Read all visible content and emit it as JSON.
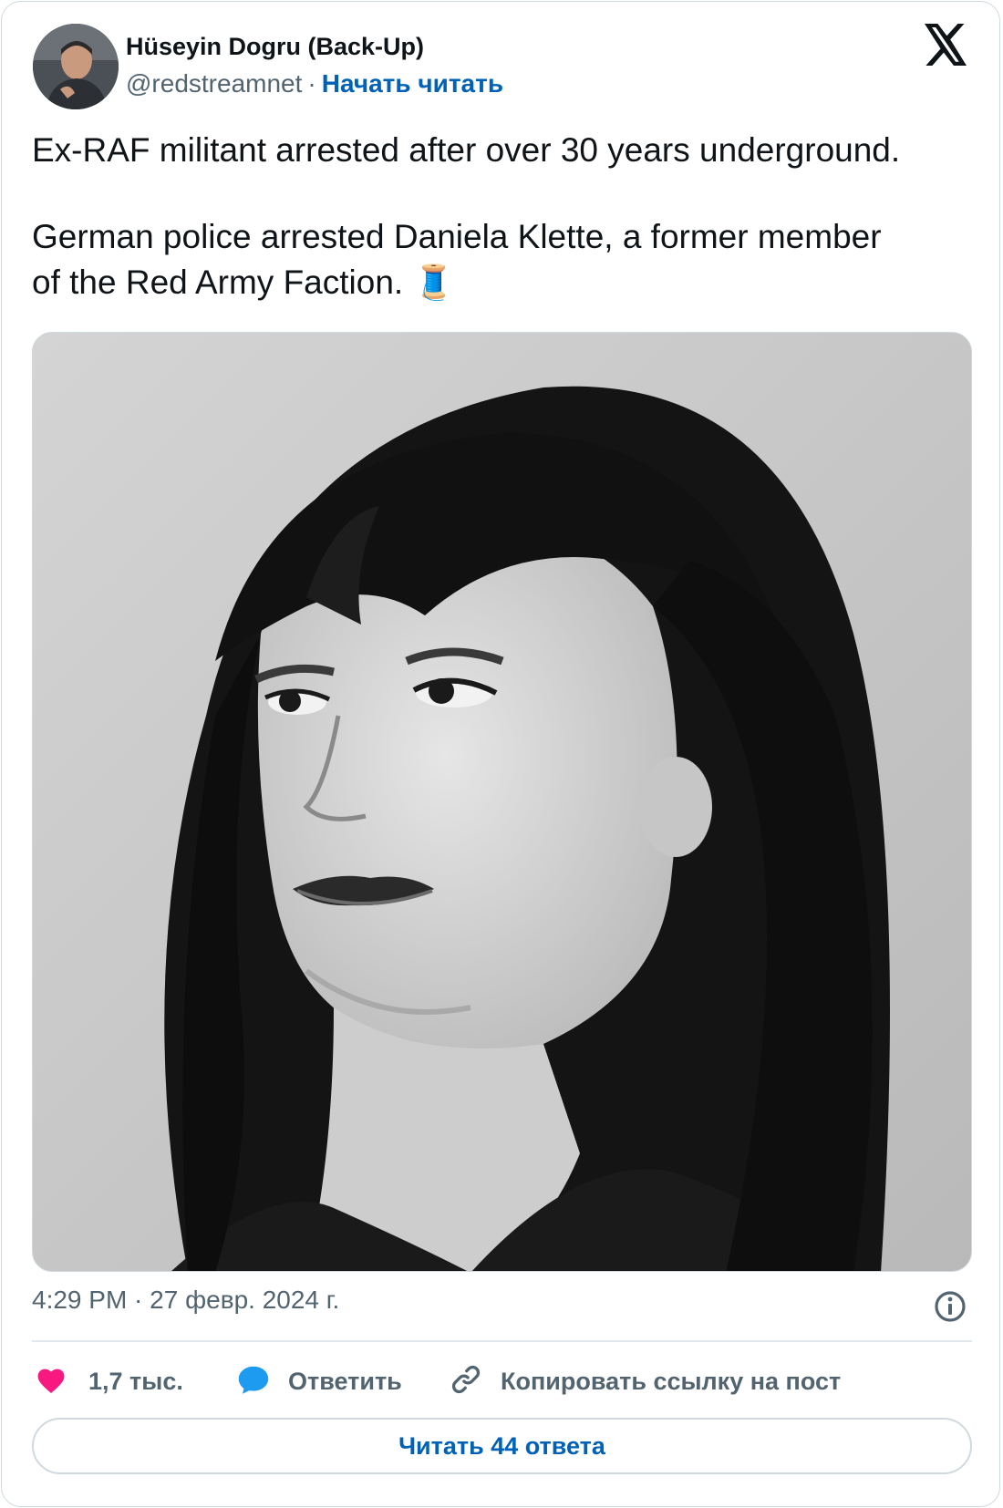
{
  "author": {
    "name": "Hüseyin Dogru (Back-Up)",
    "handle": "@redstreamnet",
    "separator": "·",
    "follow_label": "Начать читать"
  },
  "brand_icon": "x-logo-icon",
  "tweet": {
    "line1": "Ex-RAF militant arrested after over 30 years underground.",
    "line2": "German police arrested Daniela Klette, a former member",
    "line3": "of the Red Army Faction. 🧵",
    "media_description_icon": "photo"
  },
  "timestamp": "4:29 PM · 27 февр. 2024 г.",
  "actions": {
    "like_count": "1,7 тыс.",
    "reply_label": "Ответить",
    "copy_label": "Копировать ссылку на пост"
  },
  "read_replies_label": "Читать 44 ответа",
  "colors": {
    "link": "#0061b7",
    "heart": "#f91880",
    "reply_bubble": "#1d9bf0",
    "secondary_text": "#536471",
    "border": "#cfd9de"
  }
}
